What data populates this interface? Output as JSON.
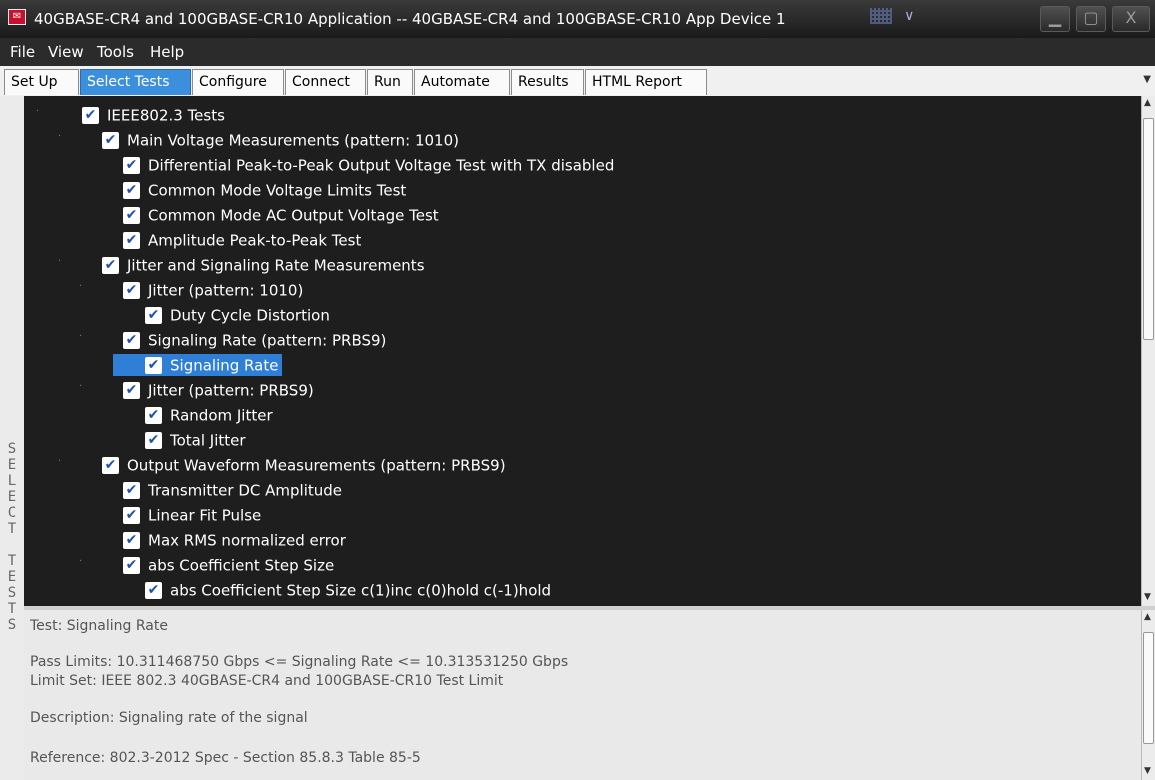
{
  "window": {
    "title": "40GBASE-CR4 and 100GBASE-CR10 Application -- 40GBASE-CR4 and 100GBASE-CR10 App Device 1",
    "icon": "app-logo-icon",
    "controls": [
      "minimize-icon",
      "maximize-icon",
      "close-icon"
    ]
  },
  "menu": [
    "File",
    "View",
    "Tools",
    "Help"
  ],
  "tabs": [
    {
      "label": "Set Up",
      "active": false
    },
    {
      "label": "Select Tests",
      "active": true
    },
    {
      "label": "Configure",
      "active": false
    },
    {
      "label": "Connect",
      "active": false
    },
    {
      "label": "Run",
      "active": false
    },
    {
      "label": "Automate",
      "active": false
    },
    {
      "label": "Results",
      "active": false
    },
    {
      "label": "HTML Report",
      "active": false
    }
  ],
  "side_label": "SELECT TESTS",
  "tree": [
    {
      "label": "IEEE802.3 Tests",
      "level": 0,
      "checked": true
    },
    {
      "label": "Main Voltage Measurements (pattern: 1010)",
      "level": 1,
      "checked": true
    },
    {
      "label": "Differential Peak-to-Peak Output Voltage Test with TX disabled",
      "level": 2,
      "checked": true
    },
    {
      "label": "Common Mode Voltage Limits Test",
      "level": 2,
      "checked": true
    },
    {
      "label": "Common Mode AC Output Voltage Test",
      "level": 2,
      "checked": true
    },
    {
      "label": "Amplitude Peak-to-Peak Test",
      "level": 2,
      "checked": true
    },
    {
      "label": "Jitter and Signaling Rate Measurements",
      "level": 1,
      "checked": true
    },
    {
      "label": "Jitter (pattern: 1010)",
      "level": 2,
      "checked": true
    },
    {
      "label": "Duty Cycle Distortion",
      "level": 3,
      "checked": true
    },
    {
      "label": "Signaling Rate (pattern: PRBS9)",
      "level": 2,
      "checked": true
    },
    {
      "label": "Signaling Rate",
      "level": 3,
      "checked": true,
      "selected": true
    },
    {
      "label": "Jitter (pattern: PRBS9)",
      "level": 2,
      "checked": true
    },
    {
      "label": "Random Jitter",
      "level": 3,
      "checked": true
    },
    {
      "label": "Total Jitter",
      "level": 3,
      "checked": true
    },
    {
      "label": "Output Waveform Measurements (pattern: PRBS9)",
      "level": 1,
      "checked": true
    },
    {
      "label": "Transmitter DC Amplitude",
      "level": 2,
      "checked": true
    },
    {
      "label": "Linear Fit Pulse",
      "level": 2,
      "checked": true
    },
    {
      "label": "Max RMS normalized error",
      "level": 2,
      "checked": true
    },
    {
      "label": "abs Coefficient Step Size",
      "level": 2,
      "checked": true
    },
    {
      "label": "abs Coefficient Step Size c(1)inc c(0)hold c(-1)hold",
      "level": 3,
      "checked": true
    }
  ],
  "info": {
    "test": "Test: Signaling Rate",
    "pass_limits": "Pass Limits: 10.311468750 Gbps <= Signaling Rate <= 10.313531250 Gbps",
    "limit_set": "Limit Set: IEEE 802.3 40GBASE-CR4 and 100GBASE-CR10 Test Limit",
    "description": "Description: Signaling rate of the signal",
    "reference": "Reference: 802.3-2012 Spec - Section 85.8.3 Table 85-5"
  },
  "colors": {
    "accent": "#3c8fdd",
    "selection": "#2f7fd6",
    "tree_bg": "#1e1e1e",
    "app_icon": "#c8102e"
  }
}
